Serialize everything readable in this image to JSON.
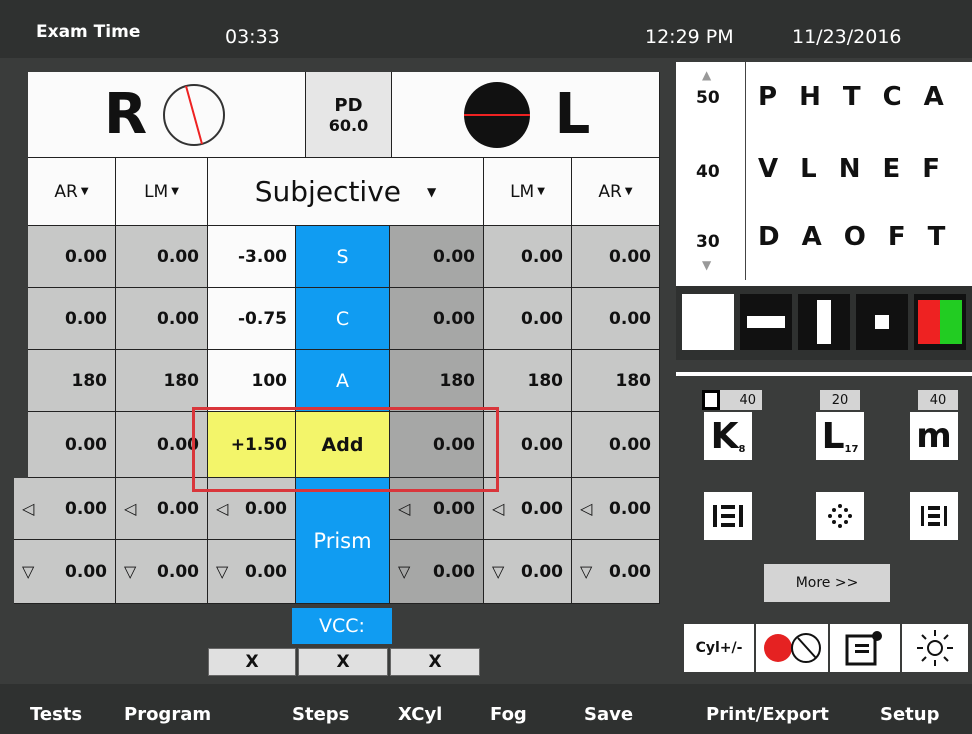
{
  "header": {
    "exam_time_label": "Exam Time",
    "exam_time": "03:33",
    "clock": "12:29 PM",
    "date": "11/23/2016"
  },
  "eyes": {
    "right_label": "R",
    "left_label": "L",
    "pd_label": "PD",
    "pd_value": "60.0"
  },
  "columns": {
    "ar_r": "AR",
    "lm_r": "LM",
    "subjective": "Subjective",
    "lm_l": "LM",
    "ar_l": "AR"
  },
  "rows": [
    {
      "param": "S",
      "ar_r": "0.00",
      "lm_r": "0.00",
      "subj_r": "-3.00",
      "subj_l": "0.00",
      "lm_l": "0.00",
      "ar_l": "0.00"
    },
    {
      "param": "C",
      "ar_r": "0.00",
      "lm_r": "0.00",
      "subj_r": "-0.75",
      "subj_l": "0.00",
      "lm_l": "0.00",
      "ar_l": "0.00"
    },
    {
      "param": "A",
      "ar_r": "180",
      "lm_r": "180",
      "subj_r": "100",
      "subj_l": "180",
      "lm_l": "180",
      "ar_l": "180"
    },
    {
      "param": "Add",
      "ar_r": "0.00",
      "lm_r": "0.00",
      "subj_r": "+1.50",
      "subj_l": "0.00",
      "lm_l": "0.00",
      "ar_l": "0.00"
    }
  ],
  "prism": {
    "label": "Prism",
    "horiz_symbol": "◁",
    "vert_symbol": "▽",
    "horizontal": {
      "ar_r": "0.00",
      "lm_r": "0.00",
      "subj_r": "0.00",
      "subj_l": "0.00",
      "lm_l": "0.00",
      "ar_l": "0.00"
    },
    "vertical": {
      "ar_r": "0.00",
      "lm_r": "0.00",
      "subj_r": "0.00",
      "subj_l": "0.00",
      "lm_l": "0.00",
      "ar_l": "0.00"
    }
  },
  "vcc": {
    "label": "VCC:",
    "x1": "X",
    "x2": "X",
    "x3": "X"
  },
  "acuity_chart": {
    "rows": [
      {
        "size": "50",
        "letters": [
          "P",
          "H",
          "T",
          "C",
          "A"
        ]
      },
      {
        "size": "40",
        "letters": [
          "V",
          "L",
          "N",
          "E",
          "F"
        ]
      },
      {
        "size": "30",
        "letters": [
          "D",
          "A",
          "O",
          "F",
          "T"
        ]
      }
    ]
  },
  "tests": {
    "sizes": [
      "40",
      "20",
      "40"
    ],
    "k_letter": "K",
    "k_sub": "8",
    "l_letter": "L",
    "l_sub": "17",
    "m_letter": "m",
    "more_label": "More >>"
  },
  "tools": {
    "cyl_label": "Cyl+/-"
  },
  "bottom_menu": {
    "tests": "Tests",
    "program": "Program",
    "steps": "Steps",
    "xcyl": "XCyl",
    "fog": "Fog",
    "save": "Save",
    "print": "Print/Export",
    "setup": "Setup"
  },
  "colors": {
    "accent_blue": "#109cf2",
    "highlight_yellow": "#f3f56a",
    "selection_red": "#d9363b"
  }
}
